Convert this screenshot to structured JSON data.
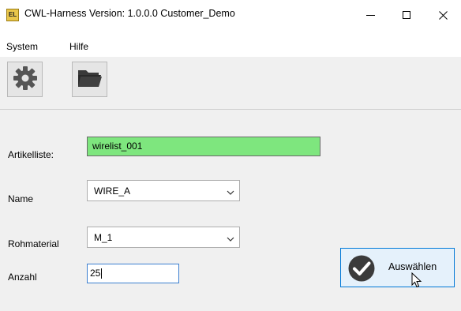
{
  "window": {
    "title": "CWL-Harness  Version: 1.0.0.0  Customer_Demo",
    "icon": "app-icon"
  },
  "menu": {
    "items": [
      {
        "label": "System"
      },
      {
        "label": "Hilfe"
      }
    ]
  },
  "toolbar": {
    "buttons": [
      {
        "icon": "gear-icon"
      },
      {
        "icon": "folder-open-icon"
      }
    ]
  },
  "form": {
    "artikelliste": {
      "label": "Artikelliste:",
      "value": "wirelist_001",
      "background": "#7ee67e"
    },
    "name": {
      "label": "Name",
      "value": "WIRE_A"
    },
    "rohmaterial": {
      "label": "Rohmaterial",
      "value": "M_1"
    },
    "anzahl": {
      "label": "Anzahl",
      "value": "25"
    }
  },
  "actions": {
    "select_label": "Auswählen",
    "select_icon": "checkmark-circle-icon",
    "accent": "#0078d7"
  }
}
